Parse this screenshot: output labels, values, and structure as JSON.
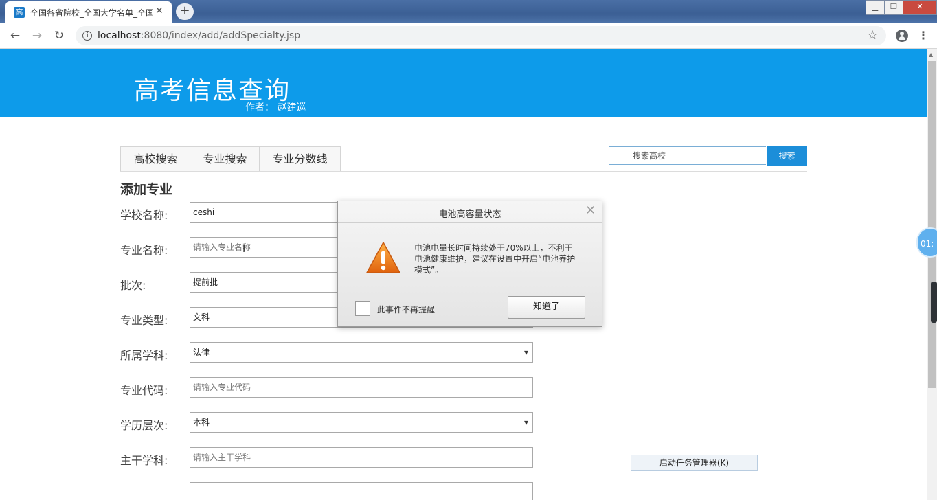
{
  "browser": {
    "tab_title": "全国各省院校_全国大学名单_全国",
    "favicon_text": "高",
    "new_tab": "+",
    "url_host": "localhost",
    "url_path": ":8080/index/add/addSpecialty.jsp",
    "window_controls": {
      "minimize": "▁",
      "maximize": "❐",
      "close": "✕"
    }
  },
  "header": {
    "title": "高考信息查询",
    "author": "作者：  赵建巡"
  },
  "nav": {
    "tabs": [
      "高校搜索",
      "专业搜索",
      "专业分数线"
    ],
    "search_placeholder": "搜索高校",
    "search_button": "搜索"
  },
  "form": {
    "heading": "添加专业",
    "fields": [
      {
        "label": "学校名称:",
        "value": "ceshi",
        "placeholder": false,
        "select": false
      },
      {
        "label": "专业名称:",
        "value": "请输入专业名称",
        "placeholder": true,
        "select": false
      },
      {
        "label": "批次:",
        "value": "提前批",
        "placeholder": false,
        "select": false
      },
      {
        "label": "专业类型:",
        "value": "文科",
        "placeholder": false,
        "select": false
      },
      {
        "label": "所属学科:",
        "value": "法律",
        "placeholder": false,
        "select": true
      },
      {
        "label": "专业代码:",
        "value": "请输入专业代码",
        "placeholder": true,
        "select": false
      },
      {
        "label": "学历层次:",
        "value": "本科",
        "placeholder": false,
        "select": true
      },
      {
        "label": "主干学科:",
        "value": "请输入主干学科",
        "placeholder": true,
        "select": false
      }
    ]
  },
  "dialog": {
    "title": "电池高容量状态",
    "message": "电池电量长时间持续处于70%以上，不利于电池健康维护，建议在设置中开启“电池养护模式”。",
    "checkbox_label": "此事件不再提醒",
    "ok_button": "知道了"
  },
  "overlay": {
    "task_manager_button": "启动任务管理器(K)",
    "clock_text": "01:"
  }
}
